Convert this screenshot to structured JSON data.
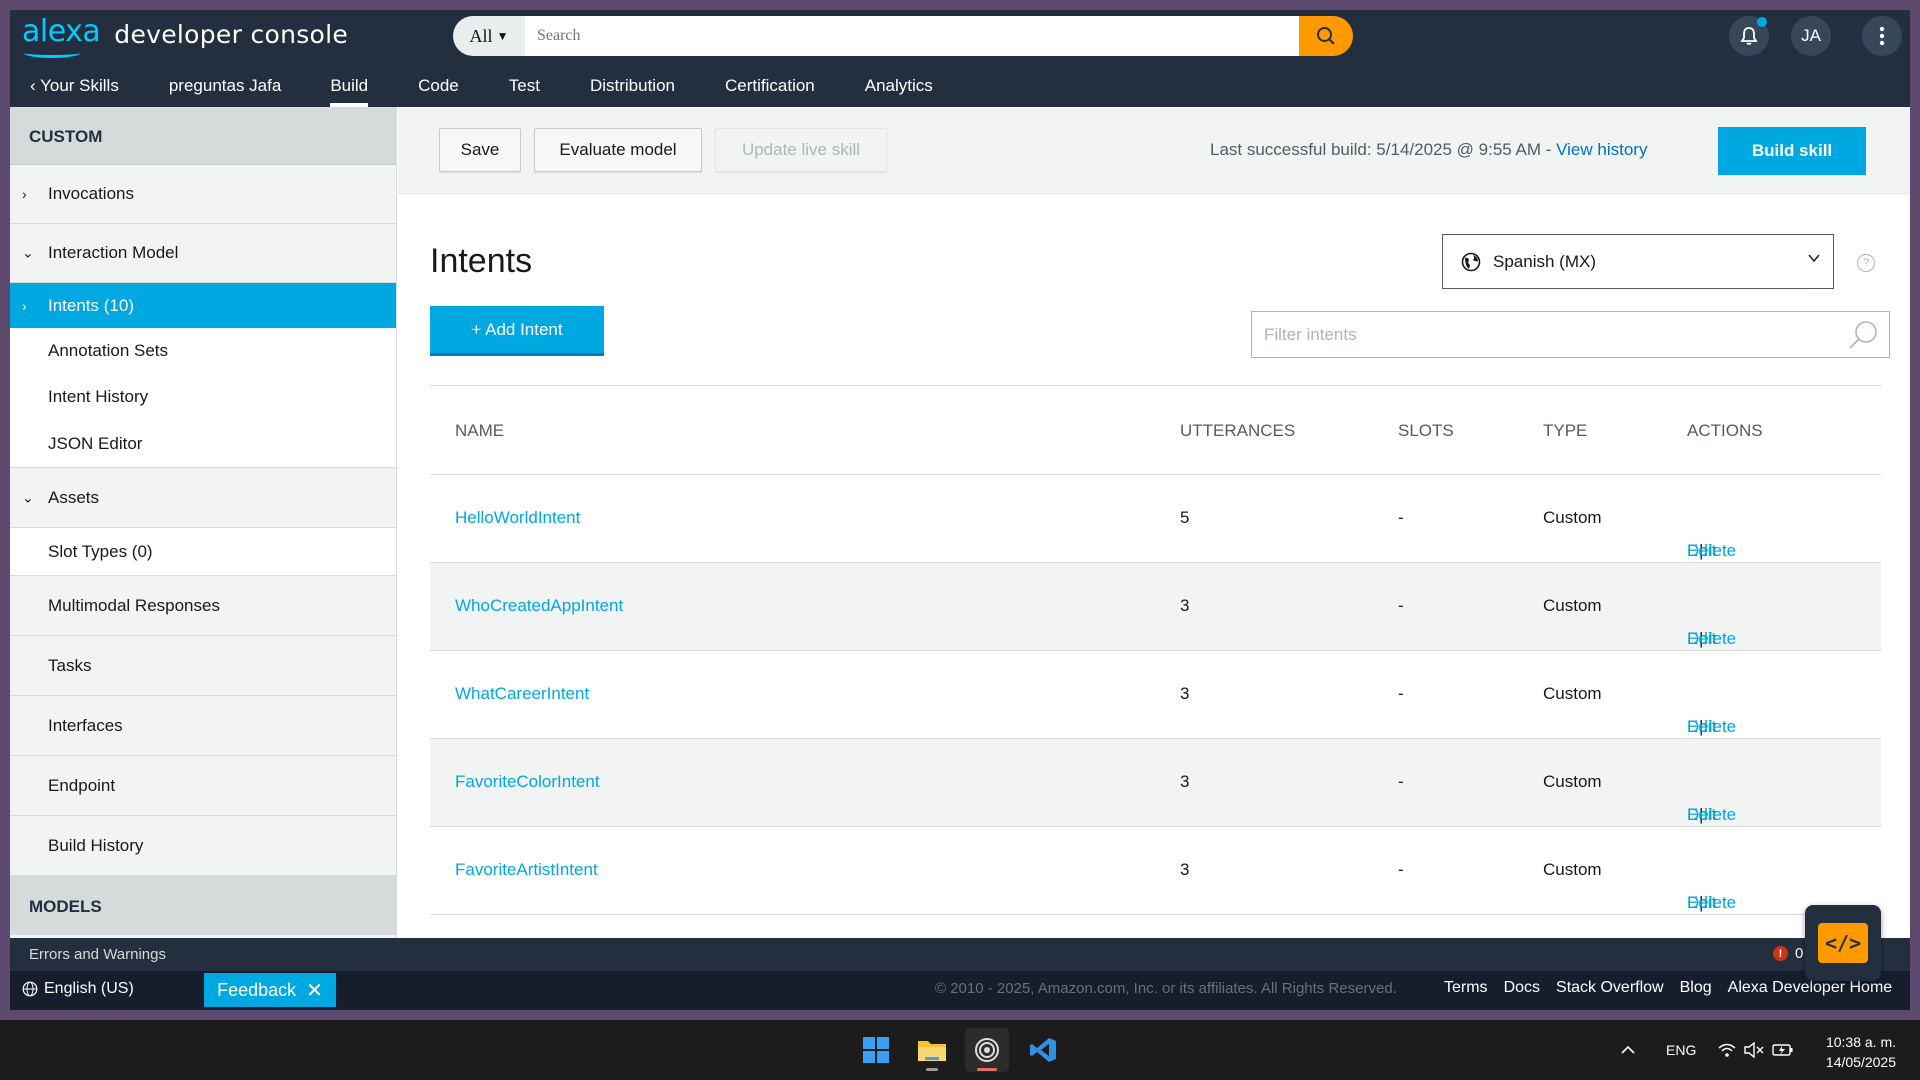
{
  "header": {
    "logo_alexa": "alexa",
    "logo_text": "developer console",
    "search_scope": "All",
    "search_placeholder": "Search",
    "user_initials": "JA"
  },
  "nav": {
    "back_label": "Your Skills",
    "skill_name": "preguntas Jafa",
    "tabs": [
      "Build",
      "Code",
      "Test",
      "Distribution",
      "Certification",
      "Analytics"
    ],
    "active_tab": "Build"
  },
  "sidebar": {
    "section_custom": "CUSTOM",
    "invocations": "Invocations",
    "interaction_model": "Interaction Model",
    "intents": "Intents (10)",
    "annotation_sets": "Annotation Sets",
    "intent_history": "Intent History",
    "json_editor": "JSON Editor",
    "assets": "Assets",
    "slot_types": "Slot Types (0)",
    "multimodal": "Multimodal Responses",
    "tasks": "Tasks",
    "interfaces": "Interfaces",
    "endpoint": "Endpoint",
    "build_history": "Build History",
    "section_models": "MODELS"
  },
  "toolbar": {
    "save": "Save",
    "evaluate": "Evaluate model",
    "update_live": "Update live skill",
    "build_info": "Last successful build: 5/14/2025 @ 9:55 AM - ",
    "view_history": "View history",
    "build_skill": "Build skill"
  },
  "main": {
    "title": "Intents",
    "add_intent": "+ Add Intent",
    "locale": "Spanish (MX)",
    "help": "?",
    "filter_placeholder": "Filter intents",
    "columns": {
      "name": "NAME",
      "utterances": "UTTERANCES",
      "slots": "SLOTS",
      "type": "TYPE",
      "actions": "ACTIONS"
    },
    "rows": [
      {
        "name": "HelloWorldIntent",
        "utterances": "5",
        "slots": "-",
        "type": "Custom",
        "edit": "Edit",
        "sep": "|",
        "delete": "Delete"
      },
      {
        "name": "WhoCreatedAppIntent",
        "utterances": "3",
        "slots": "-",
        "type": "Custom",
        "edit": "Edit",
        "sep": "|",
        "delete": "Delete"
      },
      {
        "name": "WhatCareerIntent",
        "utterances": "3",
        "slots": "-",
        "type": "Custom",
        "edit": "Edit",
        "sep": "|",
        "delete": "Delete"
      },
      {
        "name": "FavoriteColorIntent",
        "utterances": "3",
        "slots": "-",
        "type": "Custom",
        "edit": "Edit",
        "sep": "|",
        "delete": "Delete"
      },
      {
        "name": "FavoriteArtistIntent",
        "utterances": "3",
        "slots": "-",
        "type": "Custom",
        "edit": "Edit",
        "sep": "|",
        "delete": "Delete"
      }
    ]
  },
  "errors_bar": {
    "label": "Errors and Warnings",
    "error_icon": "!",
    "count": "0"
  },
  "footer": {
    "language": "English (US)",
    "feedback": "Feedback",
    "copyright": "© 2010 - 2025, Amazon.com, Inc. or its affiliates. All Rights Reserved.",
    "links": [
      "Terms",
      "Docs",
      "Stack Overflow",
      "Blog",
      "Alexa Developer Home"
    ]
  },
  "taskbar": {
    "lang": "ENG",
    "time": "10:38 a. m.",
    "date": "14/05/2025"
  },
  "colors": {
    "header_bg": "#232f3e",
    "accent": "#00a8e1",
    "search_button": "#ff9900",
    "error": "#d13212"
  }
}
